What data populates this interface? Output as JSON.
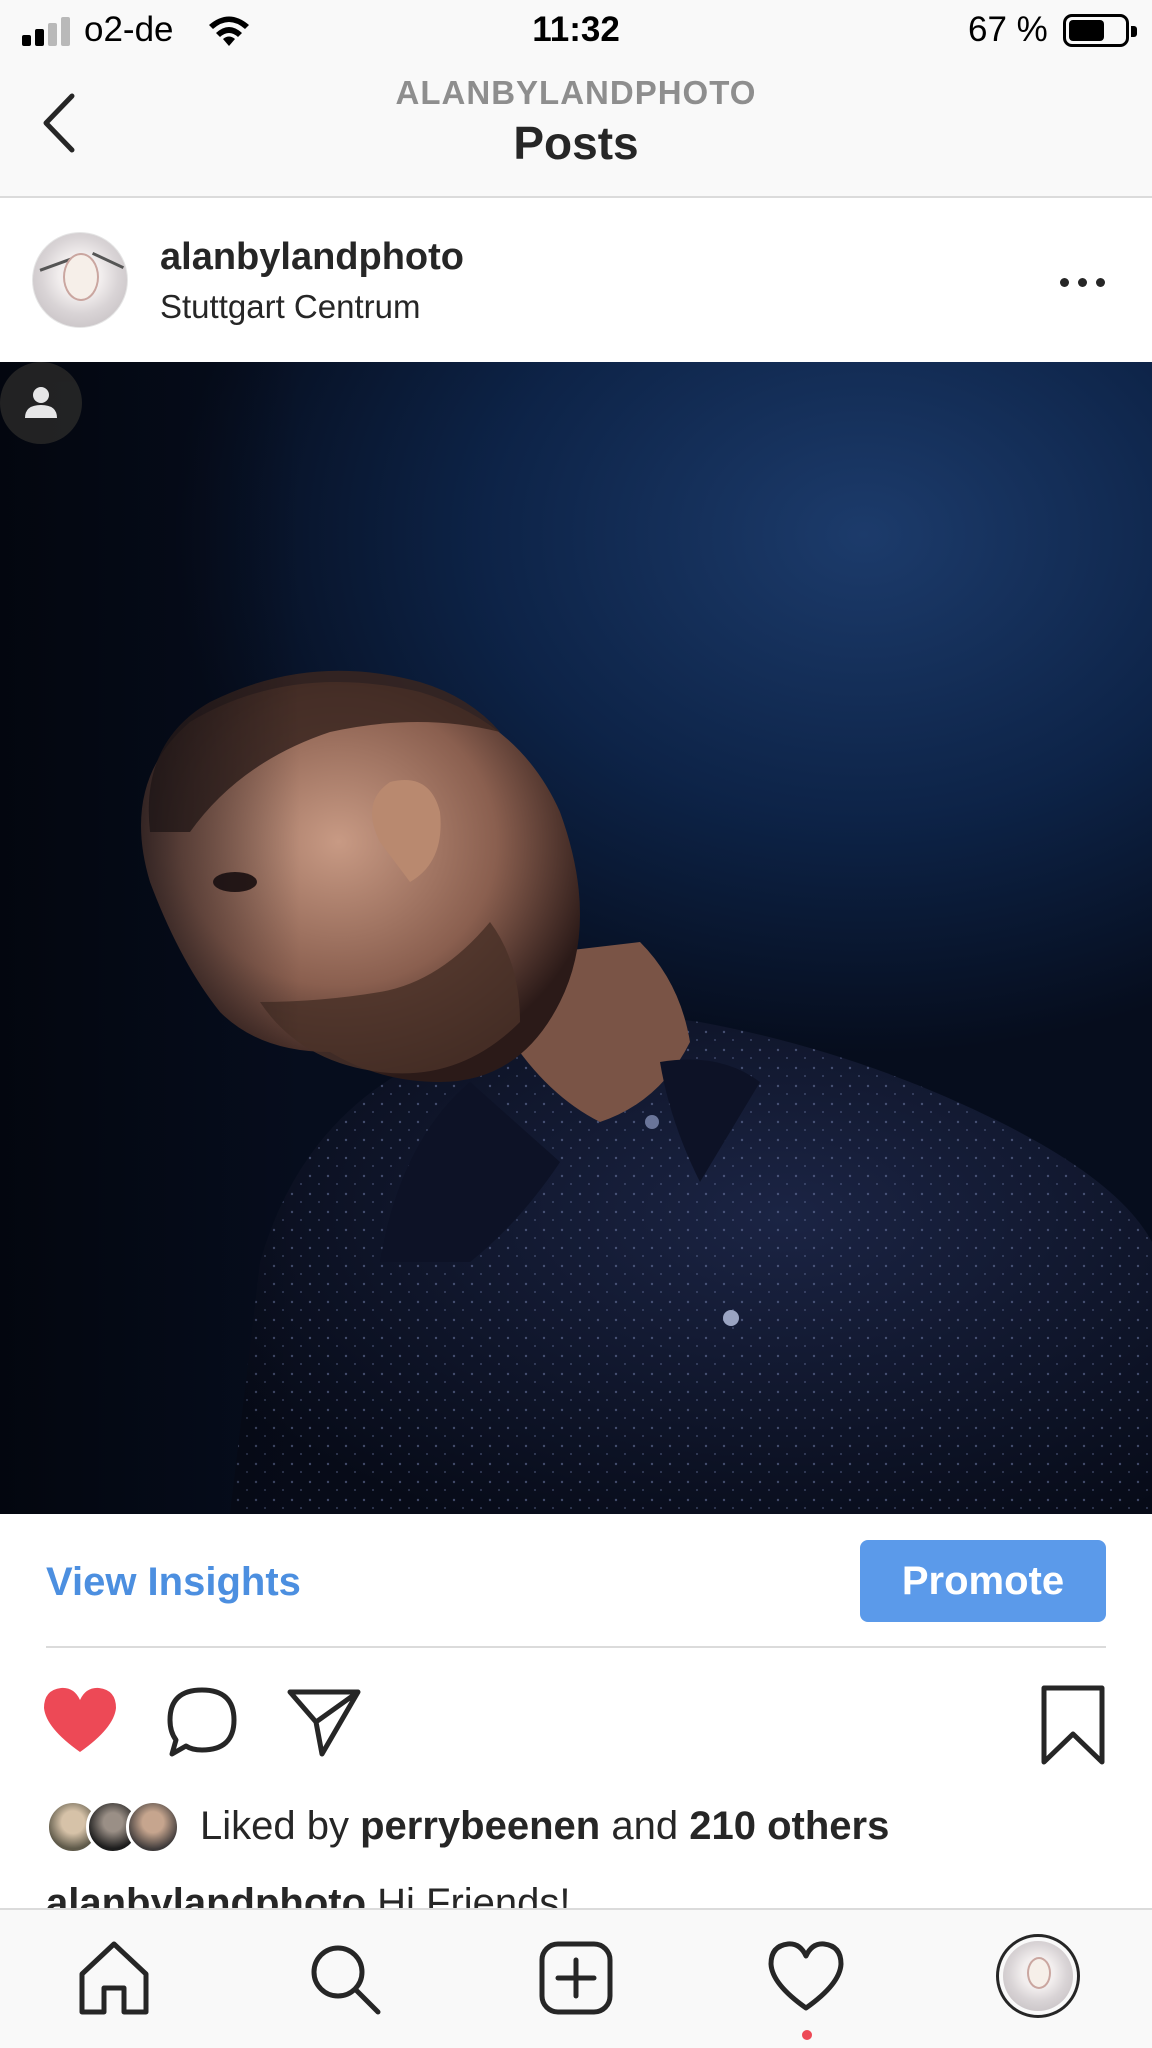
{
  "status_bar": {
    "carrier": "o2-de",
    "time": "11:32",
    "battery_percent": "67 %",
    "battery_level": 0.67
  },
  "nav": {
    "subtitle": "ALANBYLANDPHOTO",
    "title": "Posts",
    "back_icon": "chevron-left-icon"
  },
  "post": {
    "username": "alanbylandphoto",
    "location": "Stuttgart Centrum",
    "more_icon": "ellipsis-icon",
    "photo_description": "portrait photo",
    "tag_icon": "person-icon"
  },
  "insights": {
    "view_label": "View Insights",
    "promote_label": "Promote",
    "accent_color": "#4c8fe0",
    "button_color": "#5b9aea"
  },
  "actions": {
    "like_icon": "heart-filled-icon",
    "comment_icon": "comment-icon",
    "share_icon": "paper-plane-icon",
    "save_icon": "bookmark-icon",
    "like_color": "#ed4956"
  },
  "likes": {
    "prefix": "Liked by",
    "user": "perrybeenen",
    "middle": "and",
    "others": "210 others"
  },
  "caption": {
    "username": "alanbylandphoto",
    "text": "Hi Friends!"
  },
  "tab_bar": {
    "items": [
      "home-icon",
      "search-icon",
      "new-post-icon",
      "activity-heart-icon",
      "profile-avatar"
    ],
    "activity_dot_color": "#ed4956"
  }
}
